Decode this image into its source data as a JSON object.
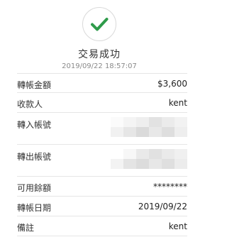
{
  "header": {
    "title": "交易成功",
    "timestamp": "2019/09/22 18:57:07",
    "check_color": "#2e9b4a"
  },
  "details": {
    "amount_label": "轉帳金額",
    "amount_value": "$3,600",
    "payee_label": "收款人",
    "payee_value": "kent",
    "to_account_label": "轉入帳號",
    "from_account_label": "轉出帳號",
    "balance_label": "可用餘額",
    "balance_value": "********",
    "date_label": "轉帳日期",
    "date_value": "2019/09/22",
    "note_label": "備註",
    "note_value": "kent"
  },
  "icons": {
    "success": "check-circle-icon",
    "redaction": "pixelated-mosaic"
  }
}
